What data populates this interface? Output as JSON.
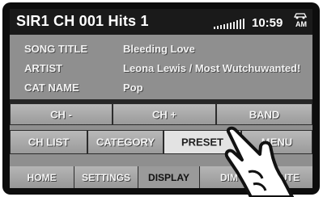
{
  "status": {
    "channel_info": "SIR1  CH 001  Hits 1",
    "clock": "10:59",
    "ampm": "AM"
  },
  "info": [
    {
      "label": "SONG TITLE",
      "value": "Bleeding Love"
    },
    {
      "label": "ARTIST",
      "value": "Leona Lewis / Most Wutchuwanted!"
    },
    {
      "label": "CAT NAME",
      "value": "Pop"
    }
  ],
  "controls": {
    "ch_minus": "CH -",
    "ch_plus": "CH +",
    "band": "BAND",
    "ch_list": "CH LIST",
    "category": "CATEGORY",
    "preset": "PRESET",
    "menu": "MENU"
  },
  "tabs": {
    "home": "HOME",
    "settings": "SETTINGS",
    "display": "DISPLAY",
    "dimmer": "DIM",
    "mute": "MUTE"
  },
  "icons": {
    "signal": "signal-strength-icon",
    "car": "car-icon",
    "pointer": "hand-pointer-icon"
  },
  "colors": {
    "screen_bg": "#8f8f8f",
    "statusbar_bg": "#1a1a1a",
    "button_face": "#aaaaaa",
    "active_button": "#e3e3e3"
  }
}
